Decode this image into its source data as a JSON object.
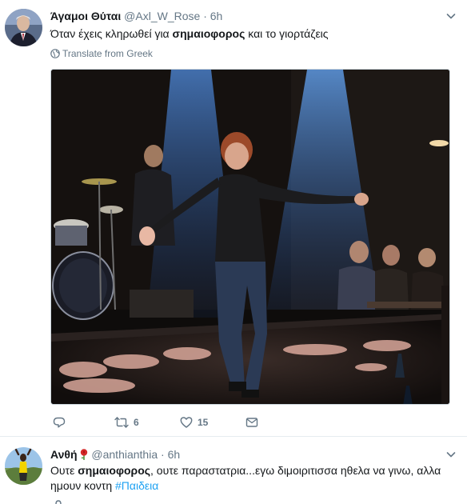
{
  "tweet1": {
    "name": "Άγαμοι Θύται",
    "handle": "@Axl_W_Rose",
    "separator": "·",
    "time": "6h",
    "text_before": "Όταν έχεις κληρωθεί για ",
    "text_bold": "σημαιοφορος",
    "text_after": " και το γιορτάζεις",
    "translate": "Translate from Greek",
    "retweets": "6",
    "likes": "15"
  },
  "tweet2": {
    "name": "Ανθή",
    "handle": "@anthianthia",
    "separator": "·",
    "time": "6h",
    "text_a": "Ουτε ",
    "text_bold": "σημαιοφορος",
    "text_b": ", ουτε παραστατρια...εγω διμοιριτισσα ηθελα να γινω, αλλα ημουν κοντη ",
    "hashtag": "#Παιδεια"
  },
  "colors": {
    "link_blue": "#1da1f2",
    "secondary_gray": "#657786",
    "divider": "#e6ecf0"
  },
  "icons": [
    "chevron-down-icon",
    "globe-icon",
    "reply-icon",
    "retweet-icon",
    "heart-icon",
    "envelope-icon",
    "rose-icon"
  ]
}
